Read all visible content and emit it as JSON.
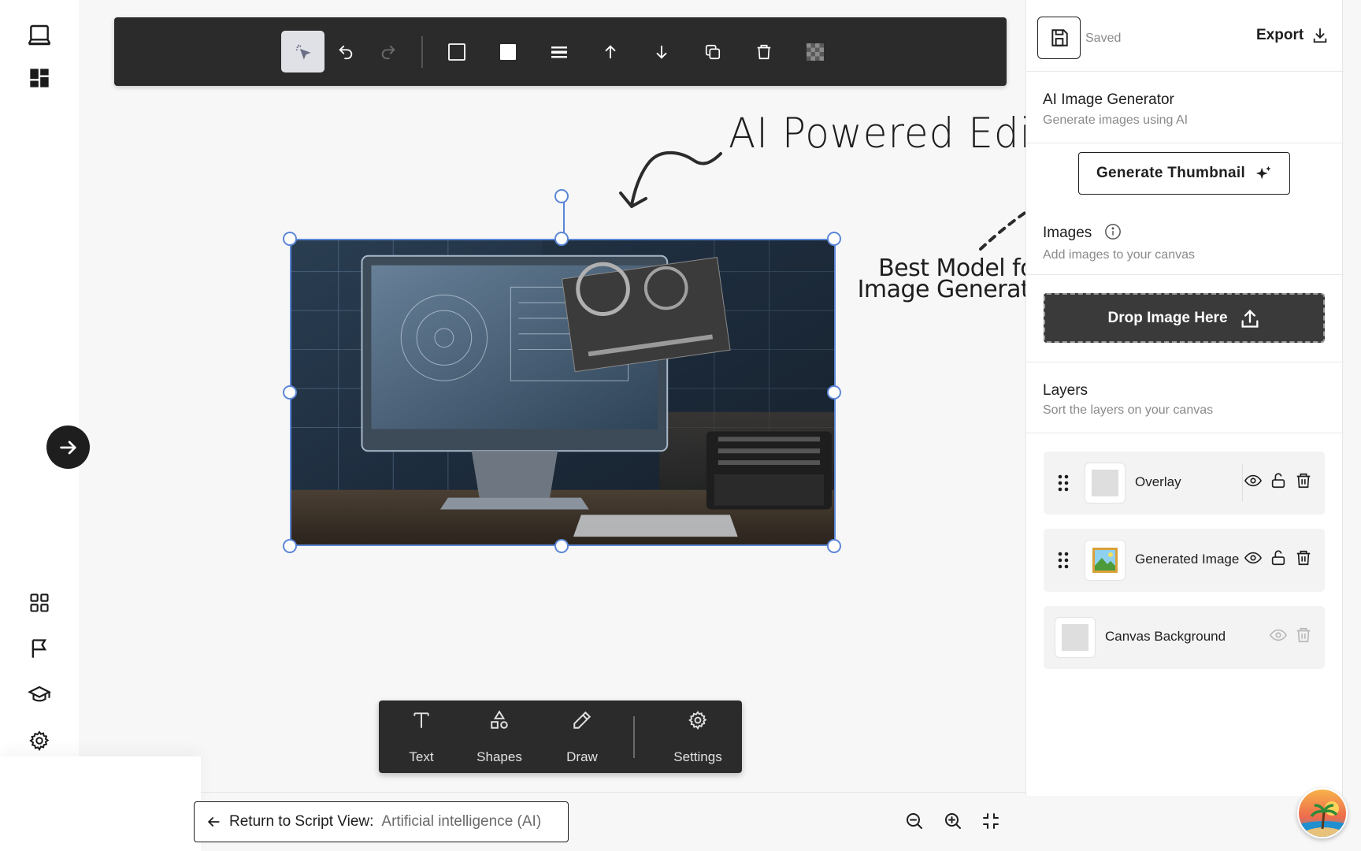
{
  "toolbar": {
    "buttons": [
      {
        "icon": "select-cursor-icon",
        "active": true
      },
      {
        "icon": "undo-icon"
      },
      {
        "icon": "redo-icon",
        "disabled": true
      },
      {
        "icon": "stroke-square-icon"
      },
      {
        "icon": "fill-square-icon"
      },
      {
        "icon": "stroke-width-icon"
      },
      {
        "icon": "bring-forward-icon"
      },
      {
        "icon": "send-backward-icon"
      },
      {
        "icon": "duplicate-icon"
      },
      {
        "icon": "delete-icon"
      },
      {
        "icon": "transparency-icon"
      }
    ]
  },
  "annotations": {
    "title": "AI Powered Editor",
    "subtitle": "Best Model for Image Generation"
  },
  "tools": {
    "items": [
      {
        "label": "Text",
        "icon": "text-icon"
      },
      {
        "label": "Shapes",
        "icon": "shapes-icon"
      },
      {
        "label": "Draw",
        "icon": "pencil-icon"
      },
      {
        "label": "Settings",
        "icon": "gear-icon"
      }
    ]
  },
  "bottom": {
    "return_label": "Return to Script View:",
    "return_topic": "Artificial intelligence (AI)"
  },
  "panel": {
    "saved_label": "Saved",
    "export_label": "Export",
    "ai": {
      "title": "AI Image Generator",
      "subtitle": "Generate images using AI",
      "generate_label": "Generate Thumbnail"
    },
    "images": {
      "title": "Images",
      "subtitle": "Add images to your canvas",
      "drop_label": "Drop Image Here"
    },
    "layers": {
      "title": "Layers",
      "subtitle": "Sort the layers on your canvas",
      "items": [
        {
          "name": "Overlay",
          "draggable": true,
          "thumb": "gray-swatch"
        },
        {
          "name": "Generated Image",
          "draggable": true,
          "thumb": "picture-icon"
        },
        {
          "name": "Canvas Background",
          "draggable": false,
          "thumb": "gray-swatch"
        }
      ]
    }
  },
  "colors": {
    "selection": "#5b86d6",
    "toolbar_bg": "#2b2b2b",
    "accent_dark": "#1e1e1e"
  }
}
